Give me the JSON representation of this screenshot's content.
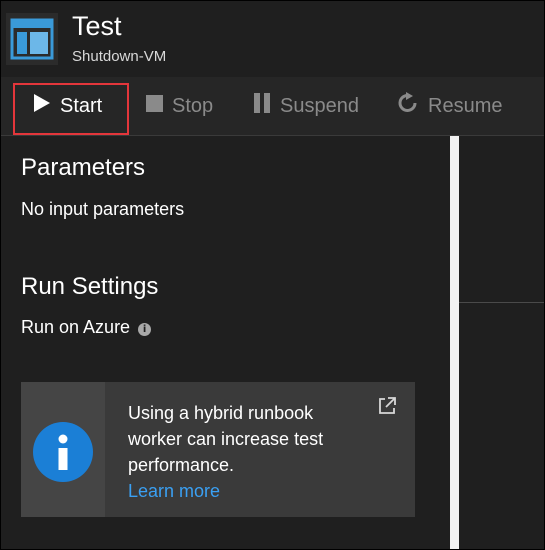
{
  "header": {
    "title": "Test",
    "subtitle": "Shutdown-VM",
    "icon": "runbook-icon"
  },
  "toolbar": {
    "start_label": "Start",
    "stop_label": "Stop",
    "suspend_label": "Suspend",
    "resume_label": "Resume",
    "active_button": "start"
  },
  "parameters": {
    "heading": "Parameters",
    "text": "No input parameters"
  },
  "run_settings": {
    "heading": "Run Settings",
    "run_on": "Run on Azure"
  },
  "callout": {
    "line1": "Using a hybrid runbook",
    "line2": "worker can increase test",
    "line3": "performance.",
    "link_label": "Learn more"
  },
  "colors": {
    "highlight": "#e3363b",
    "link": "#3aa0f3",
    "info_blue": "#1b7fd6",
    "accent_icon": "#3399dd"
  }
}
